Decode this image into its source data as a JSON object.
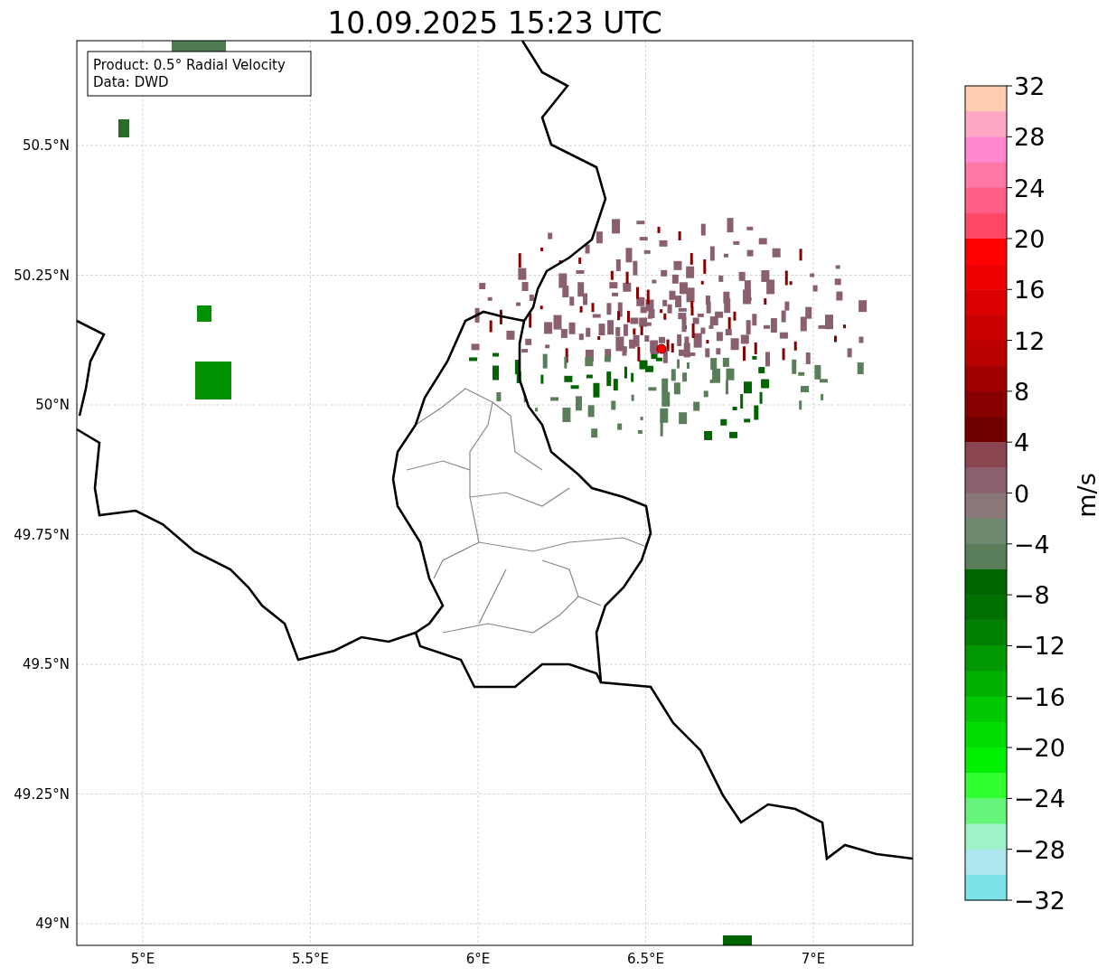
{
  "title": "10.09.2025 15:23 UTC",
  "map": {
    "info_lines": [
      "Product: 0.5° Radial Velocity",
      "Data: DWD"
    ],
    "lat_ticks": [
      "50.5°N",
      "50.25°N",
      "50°N",
      "49.75°N",
      "49.5°N",
      "49.25°N",
      "49°N"
    ],
    "lon_ticks": [
      "5°E",
      "5.5°E",
      "6°E",
      "6.5°E",
      "7°E"
    ]
  },
  "colorbar": {
    "label": "m/s",
    "ticks": [
      "32",
      "28",
      "24",
      "20",
      "16",
      "12",
      "8",
      "4",
      "0",
      "−4",
      "−8",
      "−12",
      "−16",
      "−20",
      "−24",
      "−28",
      "−32"
    ],
    "segments": [
      {
        "color": "#ffcdb2"
      },
      {
        "color": "#ffa8c5"
      },
      {
        "color": "#ff88d0"
      },
      {
        "color": "#ff78a8"
      },
      {
        "color": "#ff6088"
      },
      {
        "color": "#ff4866"
      },
      {
        "color": "#ff0000"
      },
      {
        "color": "#ee0000"
      },
      {
        "color": "#dd0000"
      },
      {
        "color": "#cc0000"
      },
      {
        "color": "#bb0000"
      },
      {
        "color": "#a00000"
      },
      {
        "color": "#880000"
      },
      {
        "color": "#700000"
      },
      {
        "color": "#8a4550"
      },
      {
        "color": "#8a6070"
      },
      {
        "color": "#8a7878"
      },
      {
        "color": "#6e8870"
      },
      {
        "color": "#5a7e5a"
      },
      {
        "color": "#006400"
      },
      {
        "color": "#007000"
      },
      {
        "color": "#008000"
      },
      {
        "color": "#009800"
      },
      {
        "color": "#00b000"
      },
      {
        "color": "#00c800"
      },
      {
        "color": "#00dd00"
      },
      {
        "color": "#00f000"
      },
      {
        "color": "#30ff30"
      },
      {
        "color": "#66f57a"
      },
      {
        "color": "#9ef2c8"
      },
      {
        "color": "#aee8ee"
      },
      {
        "color": "#7ee3e8"
      }
    ]
  }
}
